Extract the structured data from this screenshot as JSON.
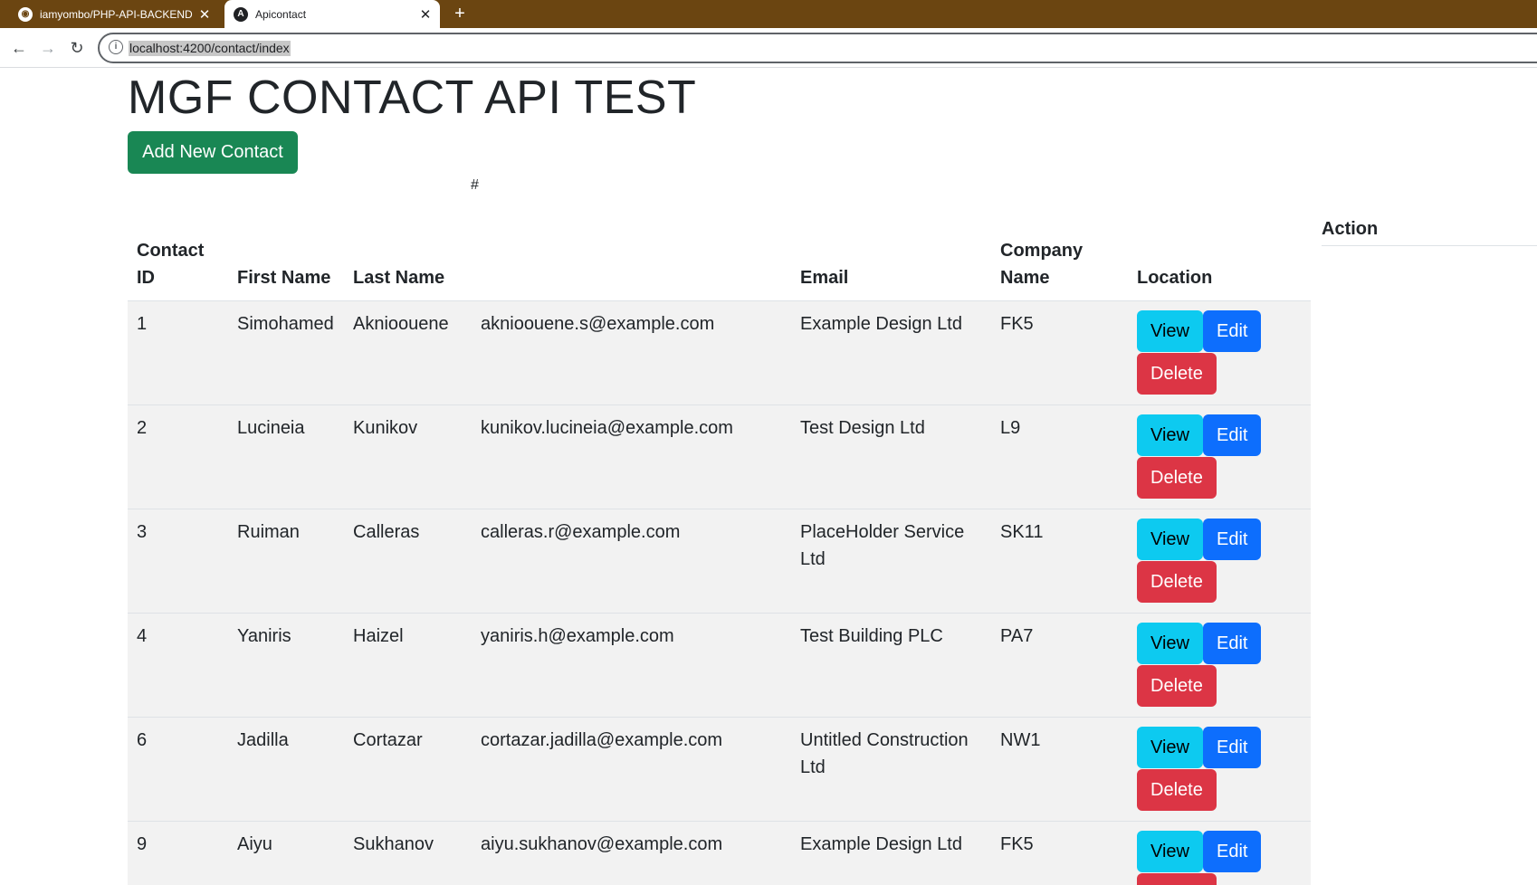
{
  "browser": {
    "tabs": [
      {
        "title": "iamyombo/PHP-API-BACKEND",
        "icon": "github-icon",
        "active": false
      },
      {
        "title": "Apicontact",
        "icon": "angular-icon",
        "active": true
      }
    ],
    "url": "localhost:4200/contact/index"
  },
  "page": {
    "heading": "MGF CONTACT API TEST",
    "add_button": "Add New Contact",
    "hash_label": "#"
  },
  "table": {
    "headers": {
      "id": "Contact ID",
      "first": "First Name",
      "last": "Last Name",
      "email": "Email",
      "company": "Company Name",
      "location": "Location",
      "action": "Action"
    },
    "actions": {
      "view": "View",
      "edit": "Edit",
      "delete": "Delete"
    },
    "rows": [
      {
        "id": "1",
        "first": "Simohamed",
        "last": "Aknioouene",
        "email": "aknioouene.s@example.com",
        "company": "Example Design Ltd",
        "location": "FK5"
      },
      {
        "id": "2",
        "first": "Lucineia",
        "last": "Kunikov",
        "email": "kunikov.lucineia@example.com",
        "company": "Test Design Ltd",
        "location": "L9"
      },
      {
        "id": "3",
        "first": "Ruiman",
        "last": "Calleras",
        "email": "calleras.r@example.com",
        "company": "PlaceHolder Service Ltd",
        "location": "SK11"
      },
      {
        "id": "4",
        "first": "Yaniris",
        "last": "Haizel",
        "email": "yaniris.h@example.com",
        "company": "Test Building PLC",
        "location": "PA7"
      },
      {
        "id": "6",
        "first": "Jadilla",
        "last": "Cortazar",
        "email": "cortazar.jadilla@example.com",
        "company": "Untitled Construction Ltd",
        "location": "NW1"
      },
      {
        "id": "9",
        "first": "Aiyu",
        "last": "Sukhanov",
        "email": "aiyu.sukhanov@example.com",
        "company": "Example Design Ltd",
        "location": "FK5"
      }
    ]
  },
  "colors": {
    "tabstrip": "#6b4511",
    "success": "#198754",
    "info": "#0dcaf0",
    "primary": "#0d6efd",
    "danger": "#dc3545",
    "stripe": "#f2f2f2"
  }
}
